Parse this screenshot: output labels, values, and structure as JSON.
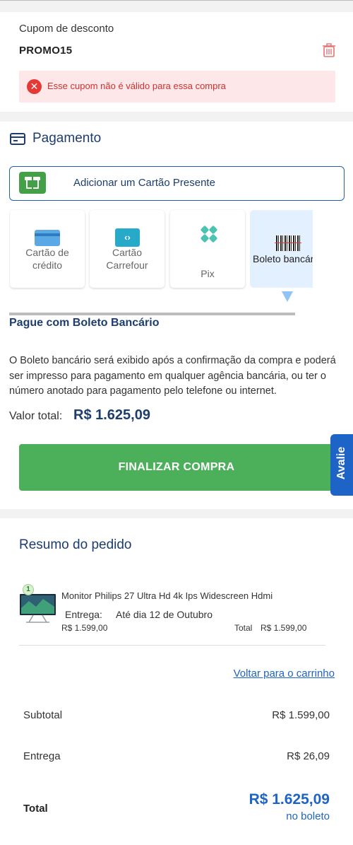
{
  "coupon": {
    "label": "Cupom de desconto",
    "code": "PROMO15",
    "error": "Esse cupom não é válido para essa compra"
  },
  "payment": {
    "title": "Pagamento",
    "gift_card_button": "Adicionar um Cartão Presente",
    "methods": [
      {
        "label": "Cartão de crédito",
        "icon": "credit-card-icon"
      },
      {
        "label": "Cartão Carrefour",
        "icon": "carrefour-card-icon"
      },
      {
        "label": "Pix",
        "icon": "pix-icon"
      },
      {
        "label": "Boleto bancário",
        "icon": "barcode-icon",
        "selected": true
      }
    ],
    "boleto": {
      "title": "Pague com Boleto Bancário",
      "description": "O Boleto bancário será exibido após a confirmação da compra e poderá ser impresso para pagamento em qualquer agência bancária, ou ter o número anotado para pagamento pelo telefone ou internet.",
      "total_label": "Valor total:",
      "total_value": "R$ 1.625,09"
    },
    "finalize_button": "FINALIZAR COMPRA"
  },
  "feedback_tab": "Avalie",
  "summary": {
    "title": "Resumo do pedido",
    "item": {
      "quantity": "1",
      "name": "Monitor Philips 27 Ultra Hd 4k Ips Widescreen Hdmi",
      "delivery_label": "Entrega:",
      "delivery_value": "Até dia 12 de Outubro",
      "unit_price": "R$ 1.599,00",
      "total_label": "Total",
      "total_value": "R$ 1.599,00"
    },
    "back_to_cart": "Voltar para o carrinho",
    "subtotal_label": "Subtotal",
    "subtotal_value": "R$ 1.599,00",
    "shipping_label": "Entrega",
    "shipping_value": "R$ 26,09",
    "total_label": "Total",
    "total_value": "R$ 1.625,09",
    "total_note": "no boleto"
  },
  "colors": {
    "primary_navy": "#1d3d6e",
    "link_blue": "#1e63c6",
    "success_green": "#4caf5a",
    "error_red": "#d32f2f",
    "error_bg": "#fde7e8"
  }
}
